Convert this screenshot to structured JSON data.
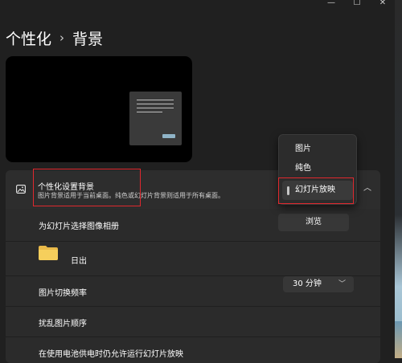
{
  "window": {
    "minimize_glyph": "—",
    "maximize_glyph": "☐",
    "close_glyph": "✕"
  },
  "breadcrumb": {
    "parent": "个性化",
    "separator": "›",
    "current": "背景"
  },
  "personalize_background": {
    "title": "个性化设置背景",
    "description": "图片背景适用于当前桌面。纯色或幻灯片背景则适用于所有桌面。",
    "icon": "image-icon",
    "expanded_icon": "chevron-up-icon"
  },
  "dropdown": {
    "options": [
      "图片",
      "纯色",
      "幻灯片放映"
    ],
    "selected_index": 2
  },
  "album": {
    "label": "为幻灯片选择图像相册",
    "browse_button": "浏览",
    "folder_name": "日出",
    "folder_icon": "folder-icon"
  },
  "frequency": {
    "label": "图片切换频率",
    "value": "30 分钟"
  },
  "shuffle": {
    "label": "扰乱图片顺序"
  },
  "battery": {
    "label": "在使用电池供电时仍允许运行幻灯片放映"
  },
  "colors": {
    "background": "#202020",
    "panel": "#2b2b2b",
    "highlight_red": "#e0282e"
  }
}
